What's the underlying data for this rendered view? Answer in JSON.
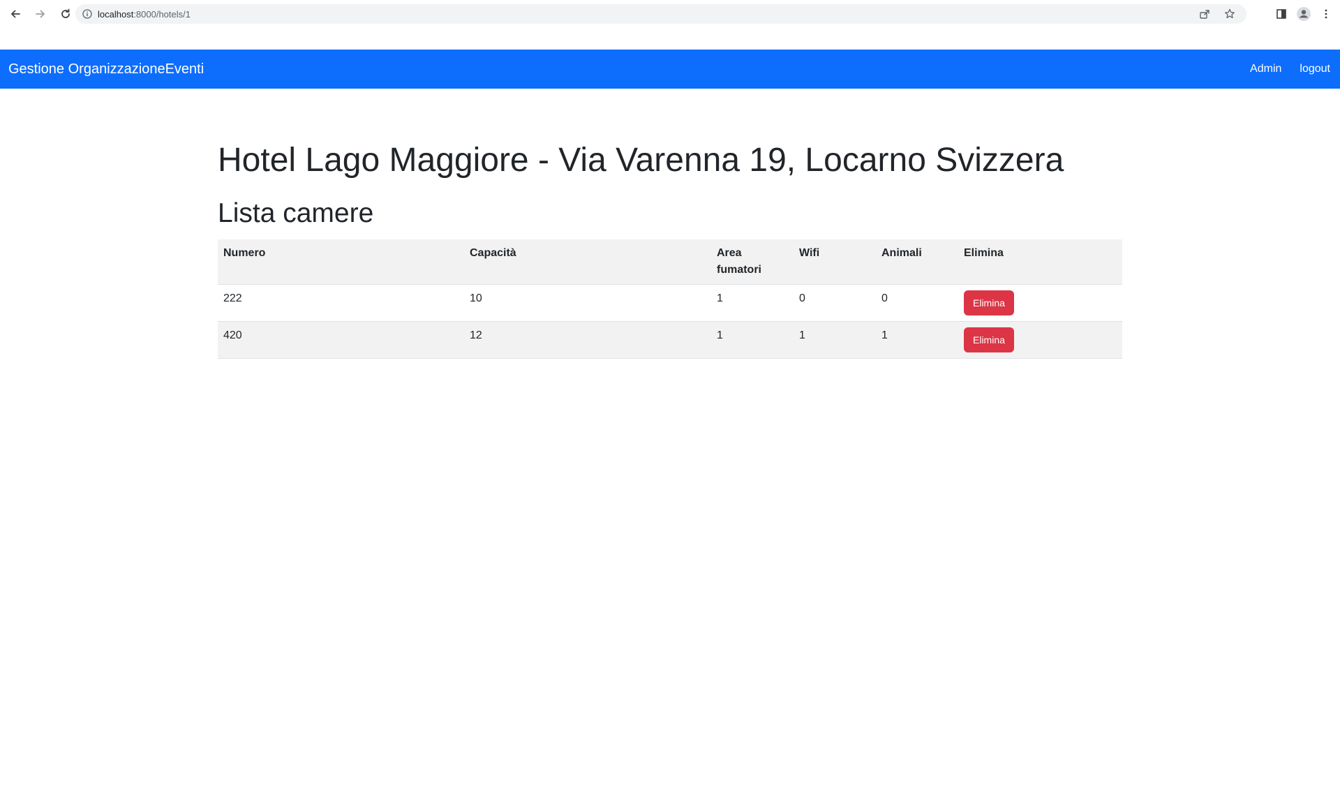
{
  "browser": {
    "url_host": "localhost",
    "url_rest": ":8000/hotels/1",
    "icons": [
      "back-arrow-icon",
      "forward-arrow-icon",
      "reload-icon",
      "info-icon",
      "share-icon",
      "star-icon",
      "side-panel-icon",
      "profile-icon",
      "menu-dots-icon"
    ]
  },
  "navbar": {
    "brand": "Gestione OrganizzazioneEventi",
    "links": [
      {
        "label": "Admin"
      },
      {
        "label": "logout"
      }
    ],
    "background": "#0d6efd"
  },
  "page": {
    "title": "Hotel Lago Maggiore - Via Varenna 19, Locarno Svizzera",
    "section_title": "Lista camere"
  },
  "table": {
    "headers": [
      "Numero",
      "Capacità",
      "Area fumatori",
      "Wifi",
      "Animali",
      "Elimina"
    ],
    "rows": [
      {
        "numero": "222",
        "capacita": "10",
        "area_fumatori": "1",
        "wifi": "0",
        "animali": "0",
        "action": "Elimina"
      },
      {
        "numero": "420",
        "capacita": "12",
        "area_fumatori": "1",
        "wifi": "1",
        "animali": "1",
        "action": "Elimina"
      }
    ]
  },
  "colors": {
    "danger": "#dc3545",
    "stripe": "#f2f2f2"
  }
}
